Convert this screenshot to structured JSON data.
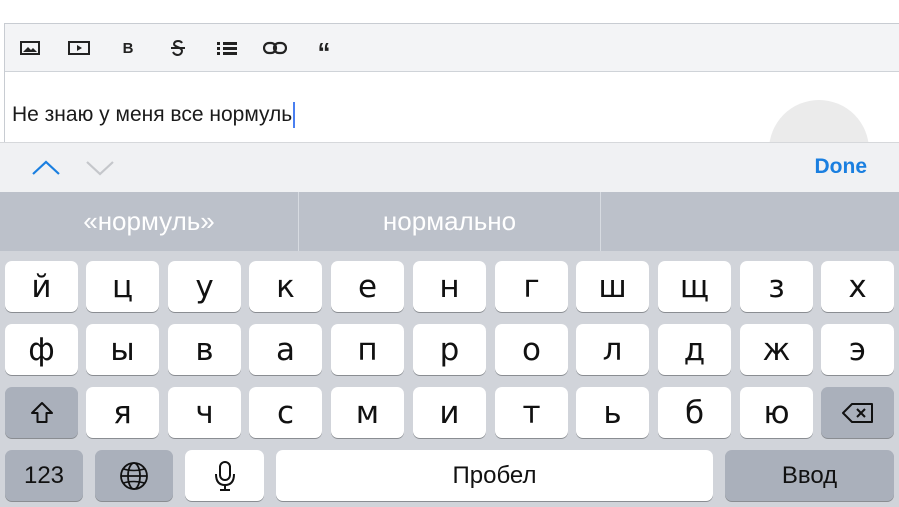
{
  "toolbar": {
    "items": [
      {
        "name": "image-icon"
      },
      {
        "name": "video-icon"
      },
      {
        "name": "bold-icon",
        "label": "B"
      },
      {
        "name": "strikethrough-icon"
      },
      {
        "name": "list-icon"
      },
      {
        "name": "link-icon"
      },
      {
        "name": "quote-icon",
        "label": "“"
      }
    ]
  },
  "editor": {
    "text": "Не знаю у меня все нормуль"
  },
  "accessory": {
    "prev_icon": "chevron-up-icon",
    "next_icon": "chevron-down-icon",
    "done_label": "Done",
    "done_color": "#1a7fe0"
  },
  "suggestions": [
    "«нормуль»",
    "нормально",
    ""
  ],
  "keyboard": {
    "row1": [
      "й",
      "ц",
      "у",
      "к",
      "е",
      "н",
      "г",
      "ш",
      "щ",
      "з",
      "х"
    ],
    "row2": [
      "ф",
      "ы",
      "в",
      "а",
      "п",
      "р",
      "о",
      "л",
      "д",
      "ж",
      "э"
    ],
    "row3": [
      "я",
      "ч",
      "с",
      "м",
      "и",
      "т",
      "ь",
      "б",
      "ю"
    ],
    "numbers_label": "123",
    "globe_icon": "globe-icon",
    "mic_icon": "microphone-icon",
    "space_label": "Пробел",
    "return_label": "Ввод",
    "shift_icon": "shift-icon",
    "backspace_icon": "backspace-icon"
  }
}
